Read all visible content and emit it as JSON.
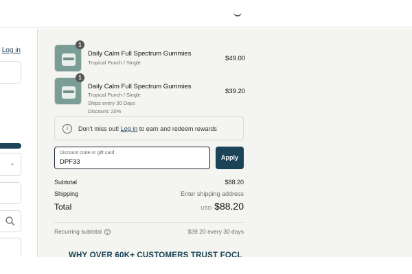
{
  "left": {
    "login_link": "Log in"
  },
  "items": [
    {
      "quantity": "1",
      "name": "Daily Calm Full Spectrum Gummies",
      "meta": [
        "Tropical Punch / Single"
      ],
      "price": "$49.00"
    },
    {
      "quantity": "1",
      "name": "Daily Calm Full Spectrum Gummies",
      "meta": [
        "Tropical Punch / Single",
        "Ships every 30 Days",
        "Discount: 20%"
      ],
      "price": "$39.20"
    }
  ],
  "notice": {
    "icon": "info-icon",
    "prefix": "Don't miss out! ",
    "link": "Log in",
    "suffix": " to earn and redeem rewards"
  },
  "discount": {
    "label": "Discount code or gift card",
    "value": "DPF33",
    "apply_label": "Apply"
  },
  "summary": {
    "subtotal_label": "Subtotal",
    "subtotal_value": "$88.20",
    "shipping_label": "Shipping",
    "shipping_value": "Enter shipping address",
    "total_label": "Total",
    "total_currency": "USD",
    "total_value": "$88.20",
    "recurring_label": "Recurring subtotal",
    "recurring_value": "$39.20 every 30 days"
  },
  "trust_heading": "WHY OVER 60K+ CUSTOMERS TRUST FOCL",
  "colors": {
    "accent": "#1b4458",
    "panel_bg": "#f4f4f0",
    "thumb": "#7a9e96"
  }
}
